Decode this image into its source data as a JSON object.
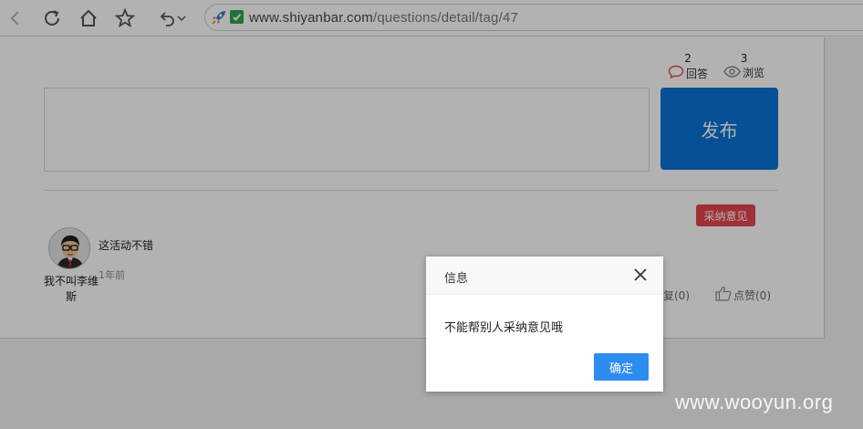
{
  "browser": {
    "url_host": "www.shiyanbar.com",
    "url_path": "/questions/detail/tag/47"
  },
  "post": {
    "stats": {
      "answers_count": "2",
      "answers_label": "回答",
      "views_count": "3",
      "views_label": "浏览"
    },
    "publish_label": "发布"
  },
  "comment": {
    "adopt_label": "采纳意见",
    "username": "我不叫李维斯",
    "text": "这活动不错",
    "time": "1年前",
    "reply_label": "回复(0)",
    "like_label": "点赞(0)"
  },
  "dialog": {
    "title": "信息",
    "message": "不能帮别人采纳意见哦",
    "ok_label": "确定"
  },
  "watermark": "www.wooyun.org",
  "colors": {
    "publish_bg": "#0a73d6",
    "adopt_bg": "#e5464c",
    "ok_bg": "#2d8cf0",
    "secure_green": "#2ea44f"
  },
  "icons": [
    "back-icon",
    "refresh-icon",
    "home-icon",
    "star-icon",
    "undo-icon",
    "chevron-down-icon",
    "rocket-icon",
    "secure-check-icon",
    "comment-icon",
    "eye-icon",
    "thumbs-up-icon",
    "close-icon"
  ]
}
